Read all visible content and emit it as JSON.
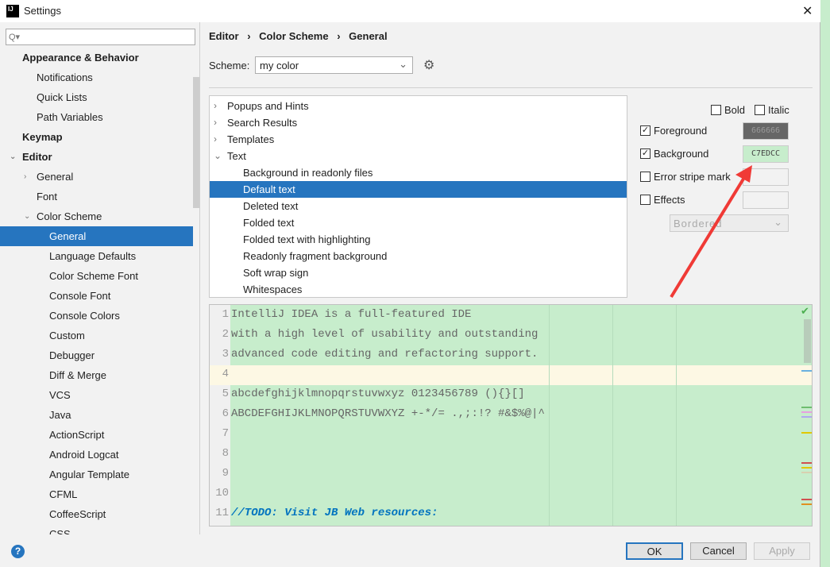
{
  "window": {
    "title": "Settings",
    "close": "✕"
  },
  "sidebar": {
    "search_placeholder": "Q▾",
    "items": [
      {
        "label": "Appearance & Behavior",
        "level": 0,
        "bold": true
      },
      {
        "label": "Notifications",
        "level": 1
      },
      {
        "label": "Quick Lists",
        "level": 1
      },
      {
        "label": "Path Variables",
        "level": 1
      },
      {
        "label": "Keymap",
        "level": 0,
        "bold": true
      },
      {
        "label": "Editor",
        "level": 0,
        "bold": true,
        "expanded": true
      },
      {
        "label": "General",
        "level": 1,
        "collapsed": true
      },
      {
        "label": "Font",
        "level": 1
      },
      {
        "label": "Color Scheme",
        "level": 1,
        "expanded": true
      },
      {
        "label": "General",
        "level": 2,
        "selected": true
      },
      {
        "label": "Language Defaults",
        "level": 2
      },
      {
        "label": "Color Scheme Font",
        "level": 2
      },
      {
        "label": "Console Font",
        "level": 2
      },
      {
        "label": "Console Colors",
        "level": 2
      },
      {
        "label": "Custom",
        "level": 2
      },
      {
        "label": "Debugger",
        "level": 2
      },
      {
        "label": "Diff & Merge",
        "level": 2
      },
      {
        "label": "VCS",
        "level": 2
      },
      {
        "label": "Java",
        "level": 2
      },
      {
        "label": "ActionScript",
        "level": 2
      },
      {
        "label": "Android Logcat",
        "level": 2
      },
      {
        "label": "Angular Template",
        "level": 2
      },
      {
        "label": "CFML",
        "level": 2
      },
      {
        "label": "CoffeeScript",
        "level": 2
      },
      {
        "label": "CSS",
        "level": 2
      }
    ]
  },
  "breadcrumb": [
    "Editor",
    "Color Scheme",
    "General"
  ],
  "scheme": {
    "label": "Scheme:",
    "value": "my color"
  },
  "list": [
    {
      "label": "Popups and Hints",
      "level": 0,
      "arrow": "›"
    },
    {
      "label": "Search Results",
      "level": 0,
      "arrow": "›"
    },
    {
      "label": "Templates",
      "level": 0,
      "arrow": "›"
    },
    {
      "label": "Text",
      "level": 0,
      "arrow": "⌄"
    },
    {
      "label": "Background in readonly files",
      "level": 1
    },
    {
      "label": "Default text",
      "level": 1,
      "selected": true
    },
    {
      "label": "Deleted text",
      "level": 1
    },
    {
      "label": "Folded text",
      "level": 1
    },
    {
      "label": "Folded text with highlighting",
      "level": 1
    },
    {
      "label": "Readonly fragment background",
      "level": 1
    },
    {
      "label": "Soft wrap sign",
      "level": 1
    },
    {
      "label": "Whitespaces",
      "level": 1
    }
  ],
  "options": {
    "bold": "Bold",
    "italic": "Italic",
    "foreground": {
      "label": "Foreground",
      "checked": true,
      "value": "666666",
      "color": "#666666"
    },
    "background": {
      "label": "Background",
      "checked": true,
      "value": "C7EDCC",
      "color": "#C7EDCC"
    },
    "error_stripe": {
      "label": "Error stripe mark",
      "checked": false
    },
    "effects": {
      "label": "Effects",
      "checked": false,
      "type": "Bordered"
    }
  },
  "preview": {
    "lines": [
      "IntelliJ IDEA is a full-featured IDE",
      "with a high level of usability and outstanding",
      "advanced code editing and refactoring support.",
      "",
      "abcdefghijklmnopqrstuvwxyz 0123456789 (){}[]",
      "ABCDEFGHIJKLMNOPQRSTUVWXYZ +-*/= .,;:!? #&$%@|^",
      "",
      "",
      "",
      "",
      "//TODO: Visit JB Web resources:"
    ],
    "numbers": [
      "1",
      "2",
      "3",
      "4",
      "5",
      "6",
      "7",
      "8",
      "9",
      "10",
      "11"
    ]
  },
  "buttons": {
    "ok": "OK",
    "cancel": "Cancel",
    "apply": "Apply",
    "help": "?"
  },
  "colors": {
    "accent": "#2675BF",
    "preview_bg": "#C7EDCC",
    "caret_row": "#FDF8E4",
    "annotation_arrow": "#F03A36",
    "todo": "#0073BF"
  }
}
